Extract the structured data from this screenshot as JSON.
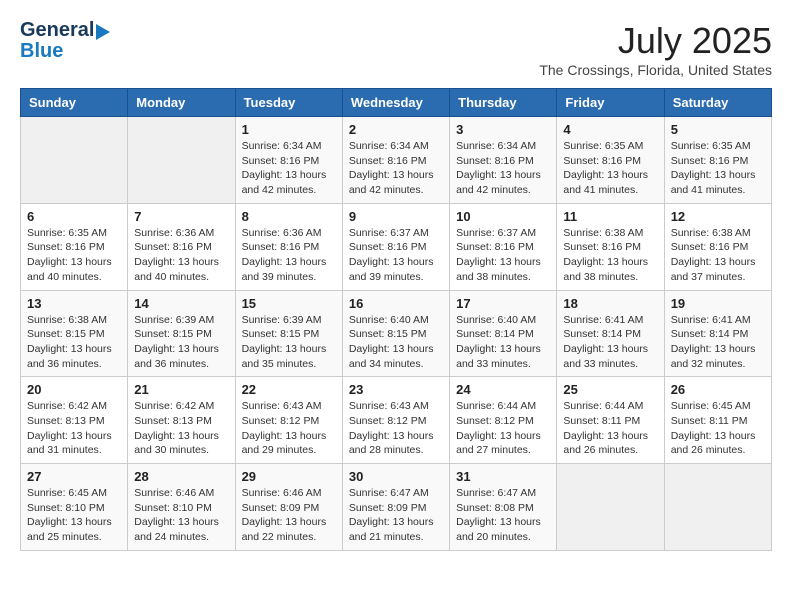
{
  "header": {
    "logo_line1": "General",
    "logo_line2": "Blue",
    "main_title": "July 2025",
    "subtitle": "The Crossings, Florida, United States"
  },
  "calendar": {
    "days_of_week": [
      "Sunday",
      "Monday",
      "Tuesday",
      "Wednesday",
      "Thursday",
      "Friday",
      "Saturday"
    ],
    "weeks": [
      [
        {
          "day": "",
          "info": ""
        },
        {
          "day": "",
          "info": ""
        },
        {
          "day": "1",
          "info": "Sunrise: 6:34 AM\nSunset: 8:16 PM\nDaylight: 13 hours and 42 minutes."
        },
        {
          "day": "2",
          "info": "Sunrise: 6:34 AM\nSunset: 8:16 PM\nDaylight: 13 hours and 42 minutes."
        },
        {
          "day": "3",
          "info": "Sunrise: 6:34 AM\nSunset: 8:16 PM\nDaylight: 13 hours and 42 minutes."
        },
        {
          "day": "4",
          "info": "Sunrise: 6:35 AM\nSunset: 8:16 PM\nDaylight: 13 hours and 41 minutes."
        },
        {
          "day": "5",
          "info": "Sunrise: 6:35 AM\nSunset: 8:16 PM\nDaylight: 13 hours and 41 minutes."
        }
      ],
      [
        {
          "day": "6",
          "info": "Sunrise: 6:35 AM\nSunset: 8:16 PM\nDaylight: 13 hours and 40 minutes."
        },
        {
          "day": "7",
          "info": "Sunrise: 6:36 AM\nSunset: 8:16 PM\nDaylight: 13 hours and 40 minutes."
        },
        {
          "day": "8",
          "info": "Sunrise: 6:36 AM\nSunset: 8:16 PM\nDaylight: 13 hours and 39 minutes."
        },
        {
          "day": "9",
          "info": "Sunrise: 6:37 AM\nSunset: 8:16 PM\nDaylight: 13 hours and 39 minutes."
        },
        {
          "day": "10",
          "info": "Sunrise: 6:37 AM\nSunset: 8:16 PM\nDaylight: 13 hours and 38 minutes."
        },
        {
          "day": "11",
          "info": "Sunrise: 6:38 AM\nSunset: 8:16 PM\nDaylight: 13 hours and 38 minutes."
        },
        {
          "day": "12",
          "info": "Sunrise: 6:38 AM\nSunset: 8:16 PM\nDaylight: 13 hours and 37 minutes."
        }
      ],
      [
        {
          "day": "13",
          "info": "Sunrise: 6:38 AM\nSunset: 8:15 PM\nDaylight: 13 hours and 36 minutes."
        },
        {
          "day": "14",
          "info": "Sunrise: 6:39 AM\nSunset: 8:15 PM\nDaylight: 13 hours and 36 minutes."
        },
        {
          "day": "15",
          "info": "Sunrise: 6:39 AM\nSunset: 8:15 PM\nDaylight: 13 hours and 35 minutes."
        },
        {
          "day": "16",
          "info": "Sunrise: 6:40 AM\nSunset: 8:15 PM\nDaylight: 13 hours and 34 minutes."
        },
        {
          "day": "17",
          "info": "Sunrise: 6:40 AM\nSunset: 8:14 PM\nDaylight: 13 hours and 33 minutes."
        },
        {
          "day": "18",
          "info": "Sunrise: 6:41 AM\nSunset: 8:14 PM\nDaylight: 13 hours and 33 minutes."
        },
        {
          "day": "19",
          "info": "Sunrise: 6:41 AM\nSunset: 8:14 PM\nDaylight: 13 hours and 32 minutes."
        }
      ],
      [
        {
          "day": "20",
          "info": "Sunrise: 6:42 AM\nSunset: 8:13 PM\nDaylight: 13 hours and 31 minutes."
        },
        {
          "day": "21",
          "info": "Sunrise: 6:42 AM\nSunset: 8:13 PM\nDaylight: 13 hours and 30 minutes."
        },
        {
          "day": "22",
          "info": "Sunrise: 6:43 AM\nSunset: 8:12 PM\nDaylight: 13 hours and 29 minutes."
        },
        {
          "day": "23",
          "info": "Sunrise: 6:43 AM\nSunset: 8:12 PM\nDaylight: 13 hours and 28 minutes."
        },
        {
          "day": "24",
          "info": "Sunrise: 6:44 AM\nSunset: 8:12 PM\nDaylight: 13 hours and 27 minutes."
        },
        {
          "day": "25",
          "info": "Sunrise: 6:44 AM\nSunset: 8:11 PM\nDaylight: 13 hours and 26 minutes."
        },
        {
          "day": "26",
          "info": "Sunrise: 6:45 AM\nSunset: 8:11 PM\nDaylight: 13 hours and 26 minutes."
        }
      ],
      [
        {
          "day": "27",
          "info": "Sunrise: 6:45 AM\nSunset: 8:10 PM\nDaylight: 13 hours and 25 minutes."
        },
        {
          "day": "28",
          "info": "Sunrise: 6:46 AM\nSunset: 8:10 PM\nDaylight: 13 hours and 24 minutes."
        },
        {
          "day": "29",
          "info": "Sunrise: 6:46 AM\nSunset: 8:09 PM\nDaylight: 13 hours and 22 minutes."
        },
        {
          "day": "30",
          "info": "Sunrise: 6:47 AM\nSunset: 8:09 PM\nDaylight: 13 hours and 21 minutes."
        },
        {
          "day": "31",
          "info": "Sunrise: 6:47 AM\nSunset: 8:08 PM\nDaylight: 13 hours and 20 minutes."
        },
        {
          "day": "",
          "info": ""
        },
        {
          "day": "",
          "info": ""
        }
      ]
    ]
  }
}
